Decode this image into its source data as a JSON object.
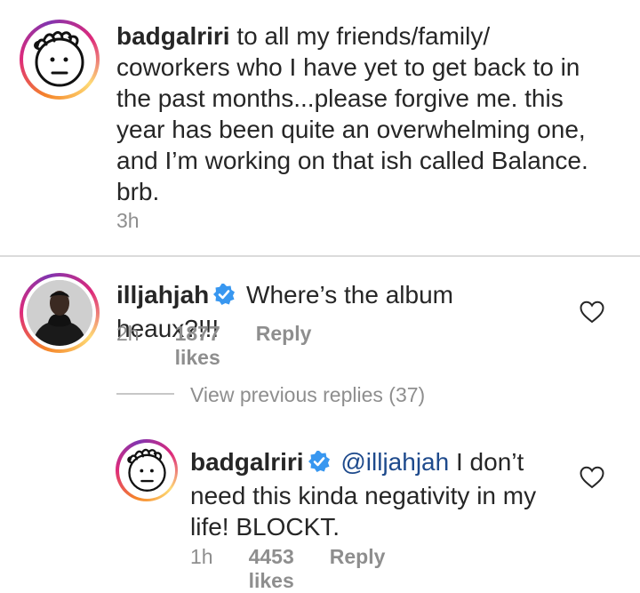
{
  "comments": [
    {
      "username": "badgalriri",
      "text": "to all my friends/family/ coworkers who I have yet to get back to in the past months...please forgive me. this year has been quite an overwhelming one, and I’m working on that ish called Balance. brb.",
      "time": "3h"
    },
    {
      "username": "illjahjah",
      "verified": true,
      "text": "Where’s the album heaux?!!!",
      "time": "2h",
      "likes": "1877 likes",
      "reply_label": "Reply"
    },
    {
      "username": "badgalriri",
      "verified": true,
      "mention": "@illjahjah",
      "text": "I don’t need this kinda negativity in my life! BLOCKT.",
      "time": "1h",
      "likes": "4453 likes",
      "reply_label": "Reply"
    }
  ],
  "view_previous_replies": "View previous replies (37)",
  "colors": {
    "text": "#262626",
    "muted": "#8e8e8e",
    "verified": "#3897f0",
    "mention": "#1e4a8c"
  }
}
